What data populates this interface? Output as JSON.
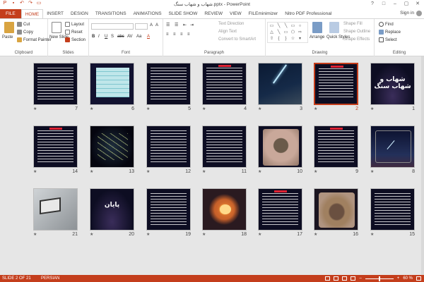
{
  "window": {
    "title": "شهاب و شهاب سنگ.pptx - PowerPoint",
    "controls": [
      "?",
      "□",
      "–",
      "▢",
      "✕"
    ]
  },
  "tabs": [
    "FILE",
    "HOME",
    "INSERT",
    "DESIGN",
    "TRANSITIONS",
    "ANIMATIONS",
    "SLIDE SHOW",
    "REVIEW",
    "VIEW",
    "FILEminimizer",
    "Nitro PDF Professional"
  ],
  "active_tab": "HOME",
  "account": {
    "signin_label": "Sign in"
  },
  "ribbon": {
    "clipboard": {
      "label": "Clipboard",
      "paste": "Paste",
      "cut": "Cut",
      "copy": "Copy",
      "format_painter": "Format Painter"
    },
    "slides": {
      "label": "Slides",
      "new_slide": "New Slide",
      "layout": "Layout",
      "reset": "Reset",
      "section": "Section"
    },
    "font": {
      "label": "Font",
      "buttons": [
        "B",
        "I",
        "U",
        "S",
        "abc",
        "AV",
        "Aa",
        "A"
      ]
    },
    "paragraph": {
      "label": "Paragraph",
      "text_direction": "Text Direction",
      "align_text": "Align Text",
      "convert_smartart": "Convert to SmartArt"
    },
    "drawing": {
      "label": "Drawing",
      "arrange": "Arrange",
      "quick_styles": "Quick Styles",
      "shape_fill": "Shape Fill",
      "shape_outline": "Shape Outline",
      "shape_effects": "Shape Effects"
    },
    "editing": {
      "label": "Editing",
      "find": "Find",
      "replace": "Replace",
      "select": "Select"
    }
  },
  "slides": [
    {
      "number": "7",
      "kind": "text"
    },
    {
      "number": "6",
      "kind": "table"
    },
    {
      "number": "5",
      "kind": "text"
    },
    {
      "number": "4",
      "kind": "text-titled"
    },
    {
      "number": "3",
      "kind": "meteor-photo"
    },
    {
      "number": "2",
      "kind": "text-titled",
      "selected": true
    },
    {
      "number": "1",
      "kind": "title",
      "title": "شهاب و شهاب سنگ"
    },
    {
      "number": "14",
      "kind": "text-titled"
    },
    {
      "number": "13",
      "kind": "star-field"
    },
    {
      "number": "12",
      "kind": "text"
    },
    {
      "number": "11",
      "kind": "text"
    },
    {
      "number": "10",
      "kind": "rock-photo"
    },
    {
      "number": "9",
      "kind": "text-titled"
    },
    {
      "number": "8",
      "kind": "meteor-sky"
    },
    {
      "number": "21",
      "kind": "laptop-photo"
    },
    {
      "number": "20",
      "kind": "title",
      "title": "پایان"
    },
    {
      "number": "19",
      "kind": "text"
    },
    {
      "number": "18",
      "kind": "fireball"
    },
    {
      "number": "17",
      "kind": "text-titled"
    },
    {
      "number": "16",
      "kind": "crater"
    },
    {
      "number": "15",
      "kind": "text"
    }
  ],
  "status": {
    "slide_indicator": "SLIDE 2 OF 21",
    "language": "PERSIAN",
    "zoom": "60 %"
  },
  "colors": {
    "accent": "#c43e1c",
    "slide_bg": "#0d0d22"
  }
}
